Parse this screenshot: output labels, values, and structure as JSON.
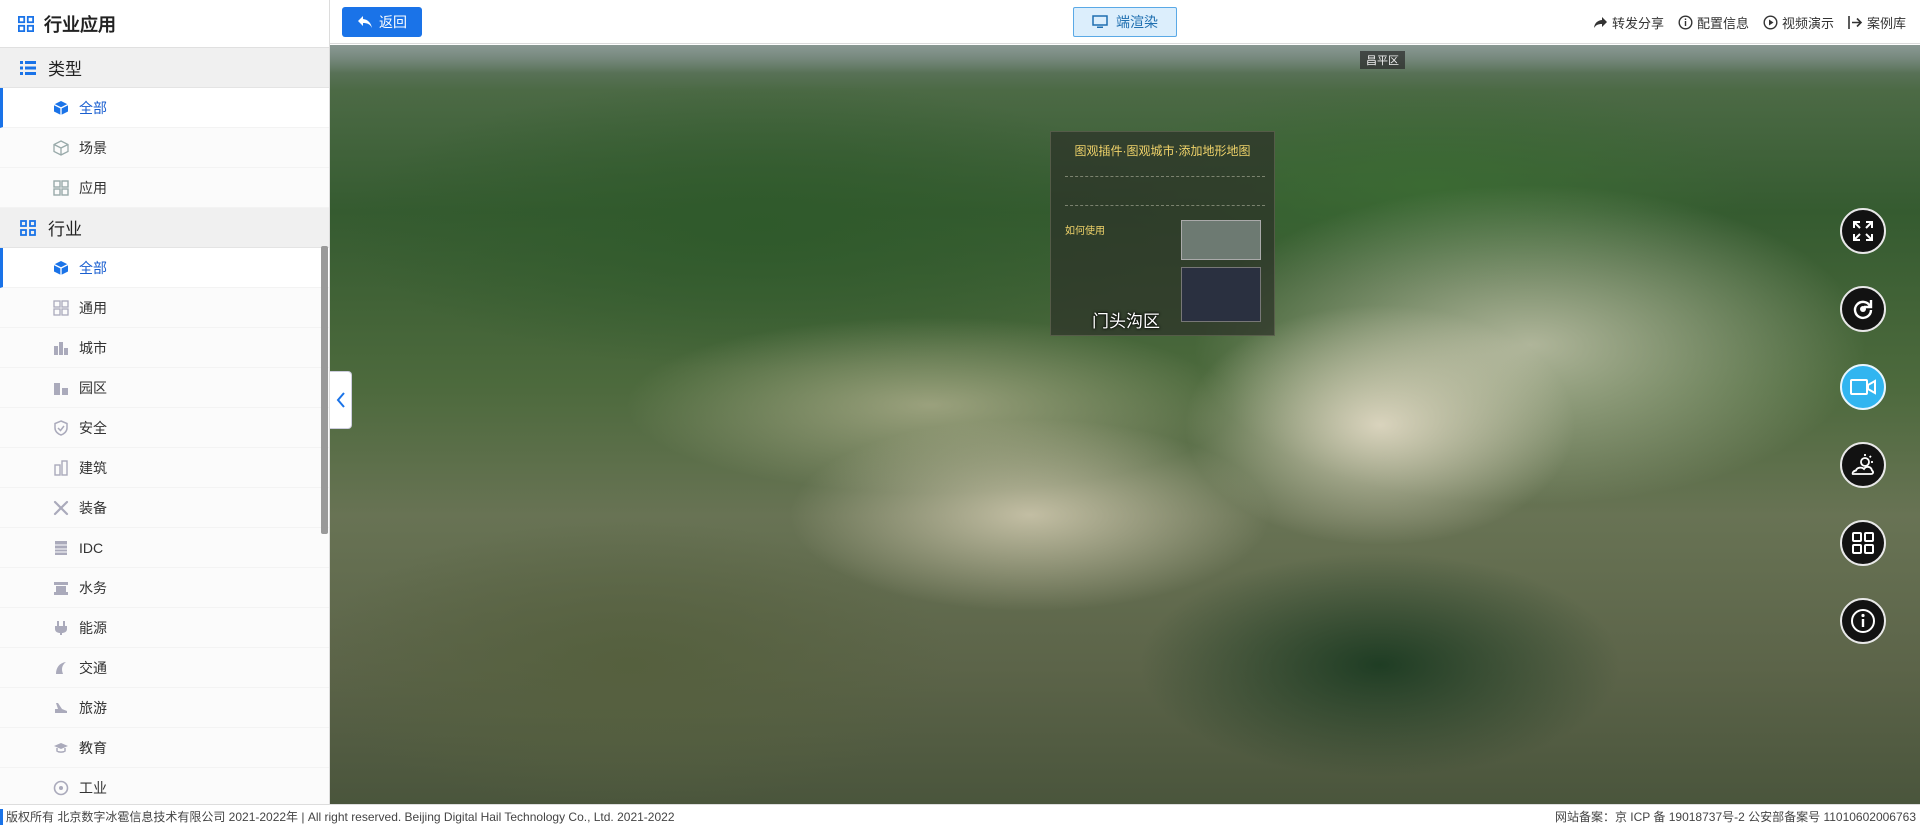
{
  "sidebar": {
    "title": "行业应用",
    "title_icon": "grid-icon",
    "type_section": {
      "label": "类型",
      "icon": "list-icon",
      "items": [
        {
          "label": "全部",
          "icon": "cube-icon",
          "active": true
        },
        {
          "label": "场景",
          "icon": "cube-outline-icon",
          "active": false
        },
        {
          "label": "应用",
          "icon": "apps-icon",
          "active": false
        }
      ]
    },
    "industry_section": {
      "label": "行业",
      "icon": "grid-icon",
      "items": [
        {
          "label": "全部",
          "icon": "cube-icon",
          "active": true
        },
        {
          "label": "通用",
          "icon": "grid-outline-icon"
        },
        {
          "label": "城市",
          "icon": "city-icon"
        },
        {
          "label": "园区",
          "icon": "park-icon"
        },
        {
          "label": "安全",
          "icon": "shield-icon"
        },
        {
          "label": "建筑",
          "icon": "building-icon"
        },
        {
          "label": "装备",
          "icon": "tools-icon"
        },
        {
          "label": "IDC",
          "icon": "server-icon"
        },
        {
          "label": "水务",
          "icon": "water-icon"
        },
        {
          "label": "能源",
          "icon": "plug-icon"
        },
        {
          "label": "交通",
          "icon": "traffic-icon"
        },
        {
          "label": "旅游",
          "icon": "travel-icon"
        },
        {
          "label": "教育",
          "icon": "education-icon"
        },
        {
          "label": "工业",
          "icon": "industry-icon"
        }
      ]
    }
  },
  "toolbar": {
    "back_label": "返回",
    "render_label": "端渲染",
    "links": [
      {
        "label": "转发分享",
        "icon": "share-icon"
      },
      {
        "label": "配置信息",
        "icon": "info-icon"
      },
      {
        "label": "视频演示",
        "icon": "play-icon"
      },
      {
        "label": "案例库",
        "icon": "library-icon"
      }
    ]
  },
  "map": {
    "district_label": "门头沟区",
    "top_tag": "昌平区",
    "panel_title": "图观插件·图观城市·添加地形地图",
    "panel_heading": "如何使用"
  },
  "tools": [
    {
      "name": "fullscreen-icon",
      "active": false
    },
    {
      "name": "rotate-icon",
      "active": false
    },
    {
      "name": "video-camera-icon",
      "active": true
    },
    {
      "name": "weather-icon",
      "active": false
    },
    {
      "name": "layers-grid-icon",
      "active": false
    },
    {
      "name": "info-icon",
      "active": false
    }
  ],
  "footer": {
    "left": "版权所有 北京数字冰雹信息技术有限公司 2021-2022年 | All right reserved. Beijing Digital Hail Technology Co., Ltd. 2021-2022",
    "right": "网站备案：京 ICP 备 19018737号-2 公安部备案号 11010602006763"
  },
  "colors": {
    "accent": "#1a73e8",
    "active_tool": "#31b5f0"
  }
}
